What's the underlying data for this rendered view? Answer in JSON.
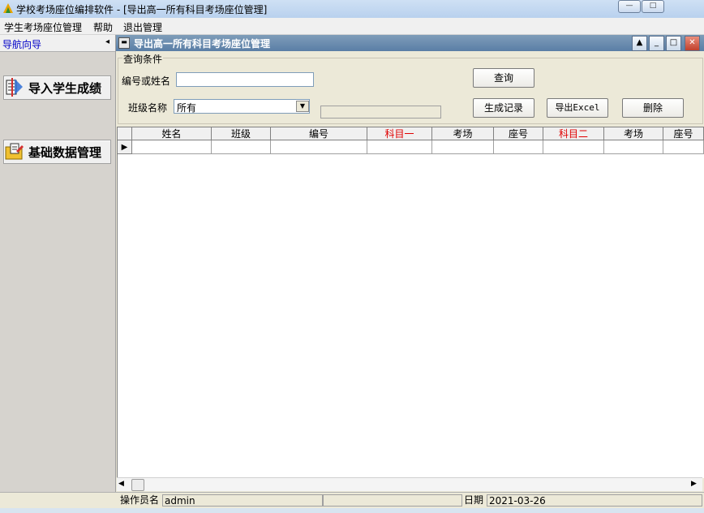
{
  "window": {
    "title": "学校考场座位编排软件  - [导出高一所有科目考场座位管理]",
    "min": "0",
    "max": "1",
    "close": "r"
  },
  "menu": [
    "学生考场座位管理",
    "帮助",
    "退出管理"
  ],
  "nav": {
    "title": "导航向导",
    "collapse_glyph": "◂",
    "items": [
      {
        "label": "导入学生成绩",
        "icon": "import-grades-icon"
      },
      {
        "label": "基础数据管理",
        "icon": "data-folder-icon"
      }
    ]
  },
  "child": {
    "title": "导出高一所有科目考场座位管理",
    "sys_glyph": "▬"
  },
  "query": {
    "legend": "查询条件",
    "name_label": "编号或姓名",
    "name_value": "",
    "class_label": "班级名称",
    "class_value": "所有",
    "search_label": "查询",
    "generate_label": "生成记录",
    "export_label": "导出Excel",
    "delete_label": "删除"
  },
  "grid": {
    "columns": [
      {
        "label": "姓名",
        "color": "#000000"
      },
      {
        "label": "班级",
        "color": "#000000"
      },
      {
        "label": "编号",
        "color": "#000000"
      },
      {
        "label": "科目一",
        "color": "#e00000"
      },
      {
        "label": "考场",
        "color": "#000000"
      },
      {
        "label": "座号",
        "color": "#000000"
      },
      {
        "label": "科目二",
        "color": "#e00000"
      },
      {
        "label": "考场",
        "color": "#000000"
      },
      {
        "label": "座号",
        "color": "#000000"
      }
    ],
    "row_indicator": "▶"
  },
  "status": {
    "operator_label": "操作员名",
    "operator_value": "admin",
    "date_label": "日期",
    "date_value": "2021-03-26"
  }
}
